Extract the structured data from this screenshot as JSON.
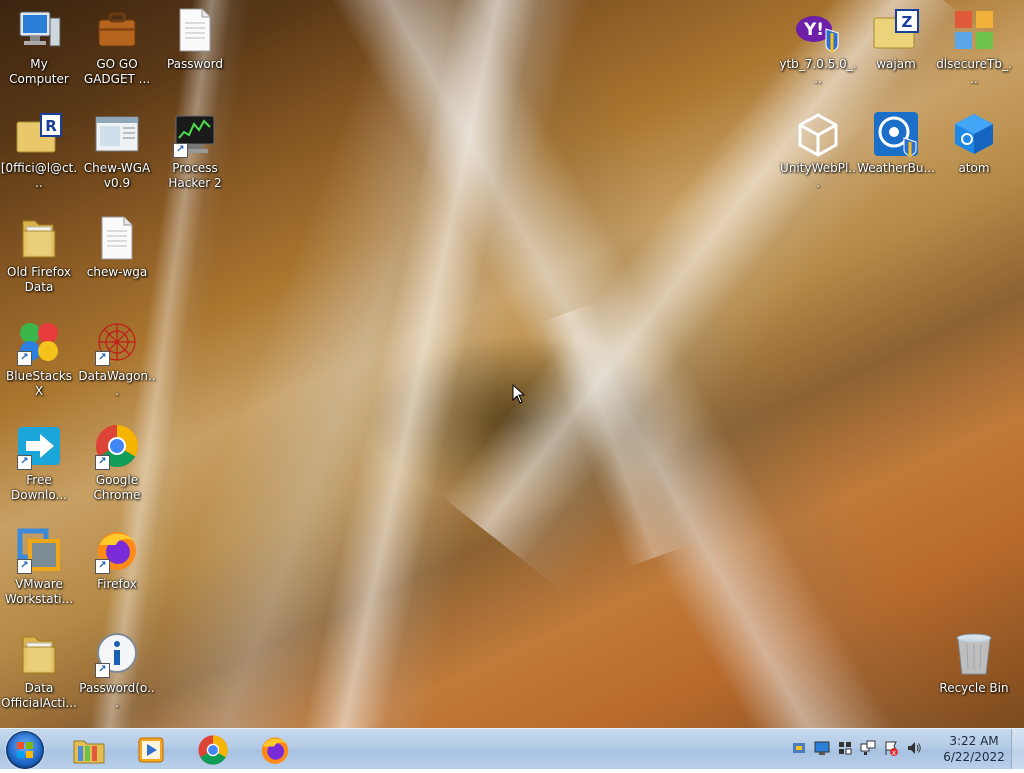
{
  "desktop": {
    "icons_left": [
      {
        "name": "my-computer",
        "label": "My Computer",
        "icon": "computer-icon",
        "shortcut": false
      },
      {
        "name": "go-go-gadget",
        "label": "GO GO GADGET ...",
        "icon": "briefcase-icon",
        "shortcut": false
      },
      {
        "name": "password",
        "label": "Password",
        "icon": "document-icon",
        "shortcut": false
      },
      {
        "name": "officiel",
        "label": "[0ffici@l@ct...",
        "icon": "rar-folder-icon",
        "shortcut": false
      },
      {
        "name": "chew-wga-app",
        "label": "Chew-WGA v0.9",
        "icon": "app-window-icon",
        "shortcut": false
      },
      {
        "name": "process-hacker",
        "label": "Process Hacker 2",
        "icon": "monitor-chart-icon",
        "shortcut": true
      },
      {
        "name": "old-firefox-data",
        "label": "Old Firefox Data",
        "icon": "folder-icon",
        "shortcut": false
      },
      {
        "name": "chew-wga",
        "label": "chew-wga",
        "icon": "document-icon",
        "shortcut": false
      },
      {
        "name": "bluestacks",
        "label": "BlueStacks X",
        "icon": "bluestacks-icon",
        "shortcut": true
      },
      {
        "name": "datawagon",
        "label": "DataWagon...",
        "icon": "datawagon-icon",
        "shortcut": true
      },
      {
        "name": "free-download",
        "label": "Free Downlo...",
        "icon": "download-arrow-icon",
        "shortcut": true
      },
      {
        "name": "google-chrome",
        "label": "Google Chrome",
        "icon": "chrome-icon",
        "shortcut": true
      },
      {
        "name": "vmware",
        "label": "VMware Workstati...",
        "icon": "vmware-icon",
        "shortcut": true
      },
      {
        "name": "firefox",
        "label": "Firefox",
        "icon": "firefox-icon",
        "shortcut": true
      },
      {
        "name": "data-officialacti",
        "label": "Data OfficialActi...",
        "icon": "folder-icon",
        "shortcut": false
      },
      {
        "name": "password-o",
        "label": "Password(o...",
        "icon": "info-icon",
        "shortcut": true
      }
    ],
    "icons_right": [
      {
        "name": "ytb",
        "label": "ytb_7.0.5.0_...",
        "icon": "yahoo-icon",
        "shortcut": false
      },
      {
        "name": "wajam",
        "label": "wajam",
        "icon": "zip-folder-icon",
        "shortcut": false
      },
      {
        "name": "dlsecuretb",
        "label": "dlsecureTb_...",
        "icon": "puzzle-icon",
        "shortcut": false
      },
      {
        "name": "unity-webplayer",
        "label": "UnityWebPl...",
        "icon": "unity-icon",
        "shortcut": false
      },
      {
        "name": "weatherbug",
        "label": "WeatherBu...",
        "icon": "weatherbug-icon",
        "shortcut": false
      },
      {
        "name": "atom",
        "label": "atom",
        "icon": "atom-cube-icon",
        "shortcut": false
      },
      {
        "name": "recycle-bin",
        "label": "Recycle Bin",
        "icon": "recycle-bin-icon",
        "shortcut": false
      }
    ]
  },
  "taskbar": {
    "pinned": [
      {
        "name": "explorer",
        "icon": "folder-library-icon"
      },
      {
        "name": "media-player",
        "icon": "media-player-icon"
      },
      {
        "name": "chrome",
        "icon": "chrome-icon"
      },
      {
        "name": "firefox",
        "icon": "firefox-icon"
      }
    ],
    "tray": [
      "tray-network-share-icon",
      "tray-monitor-icon",
      "tray-windows-icon",
      "tray-network-icon",
      "tray-flag-icon",
      "tray-volume-icon"
    ],
    "clock": {
      "time": "3:22 AM",
      "date": "6/22/2022"
    }
  },
  "colors": {
    "taskbar": "#b3cbe6",
    "label_text": "#ffffff"
  }
}
